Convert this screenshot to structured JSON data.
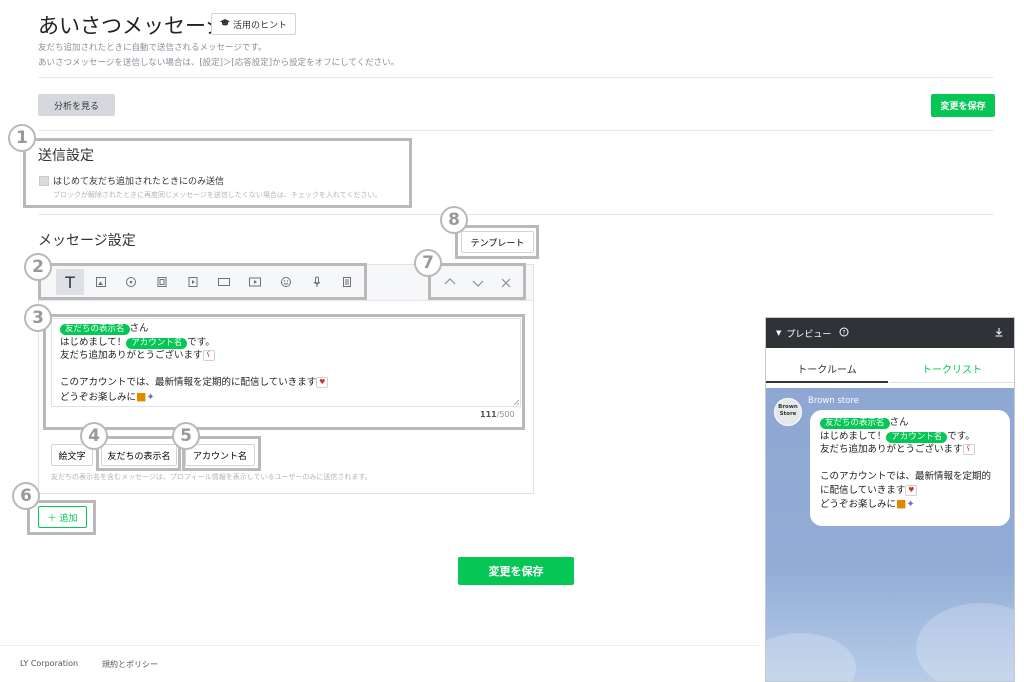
{
  "header": {
    "title": "あいさつメッセージ",
    "hint_button": "活用のヒント",
    "desc1": "友だち追加されたときに自動で送信されるメッセージです。",
    "desc2": "あいさつメッセージを送信しない場合は、[設定]＞[応答設定]から設定をオフにしてください。"
  },
  "toolbar": {
    "analysis_button": "分析を見る",
    "save_button": "変更を保存"
  },
  "send_settings": {
    "heading": "送信設定",
    "checkbox_label": "はじめて友だち追加されたときにのみ送信",
    "checkbox_note": "ブロックが解除されたときに再度同じメッセージを送信したくない場合は、チェックを入れてください。"
  },
  "message_settings": {
    "heading": "メッセージ設定",
    "template_button": "テンプレート",
    "tool_icons": [
      "text-icon",
      "image-icon",
      "stamp-icon",
      "coupon-icon",
      "video-icon",
      "rich-message-icon",
      "rich-video-icon",
      "survey-icon",
      "voice-icon",
      "card-icon"
    ],
    "text_tool_glyph": "T",
    "message": {
      "tag_friend": "友だちの表示名",
      "line1_suffix": "さん",
      "line2_prefix": "はじめまして！",
      "tag_account": "アカウント名",
      "line2_suffix": "です。",
      "line3": "友だち追加ありがとうございます",
      "line4": "このアカウントでは、最新情報を定期的に配信していきます",
      "line5": "どうぞお楽しみに"
    },
    "char_count": "111",
    "char_limit": "/500",
    "insert_buttons": [
      "絵文字",
      "友だちの表示名",
      "アカウント名"
    ],
    "insert_note": "友だちの表示名を含むメッセージは、プロフィール情報を表示しているユーザーのみに送信されます。",
    "add_button": "追加"
  },
  "bottom": {
    "save_button": "変更を保存"
  },
  "footer": {
    "copyright": "LY Corporation",
    "policy_link": "規約とポリシー"
  },
  "preview": {
    "title": "プレビュー",
    "tab_room": "トークルーム",
    "tab_list": "トークリスト",
    "sender": "Brown store",
    "avatar_text1": "Brown",
    "avatar_text2": "Store",
    "line4a": "このアカウントでは、最新情報を定期的",
    "line4b": "に配信していきます"
  },
  "callouts": [
    "1",
    "2",
    "3",
    "4",
    "5",
    "6",
    "7",
    "8"
  ],
  "colors": {
    "accent": "#06c755",
    "callout": "#b9b9b9",
    "preview_header": "#2f3338"
  }
}
